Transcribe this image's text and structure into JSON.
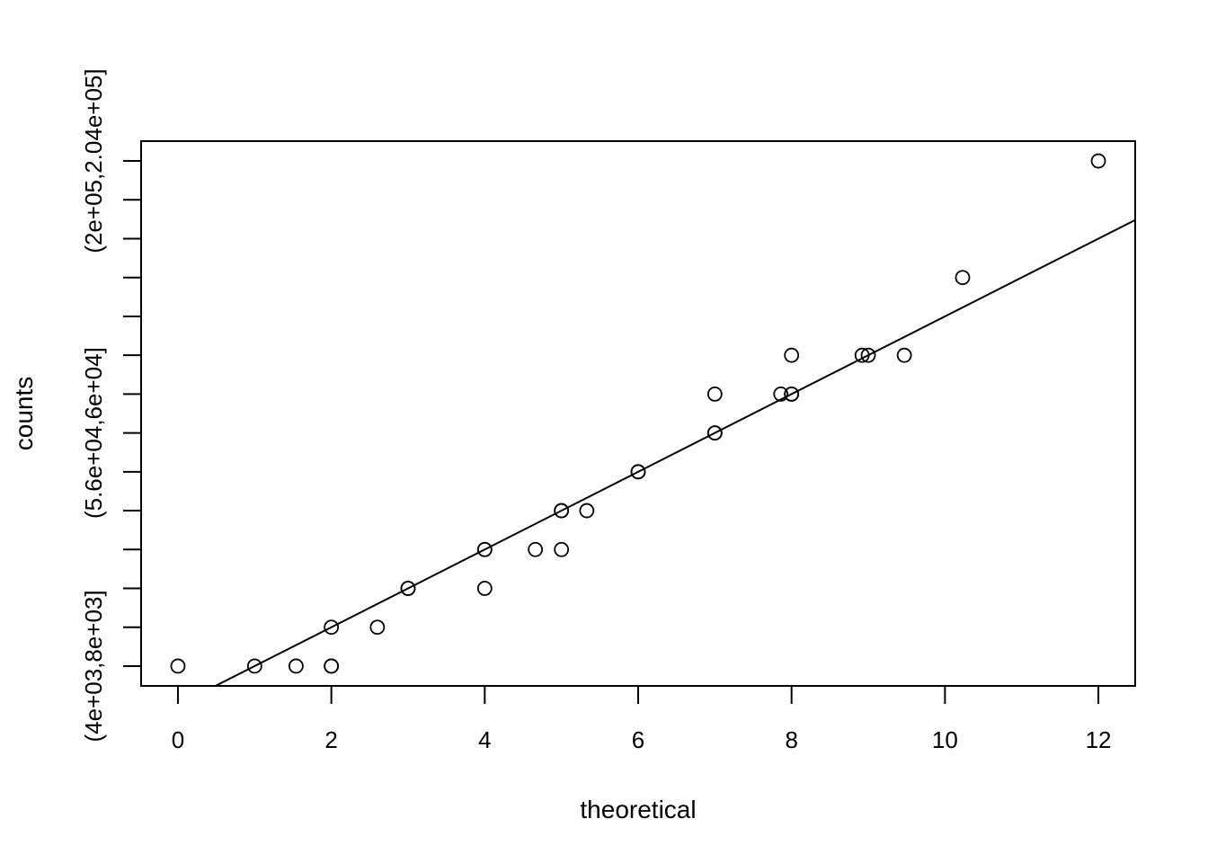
{
  "chart_data": {
    "type": "scatter",
    "title": "",
    "xlabel": "theoretical",
    "ylabel": "counts",
    "xlim": [
      -0.48,
      12.48
    ],
    "ylim_levels": [
      0.49,
      14.51
    ],
    "x_ticks": [
      0,
      2,
      4,
      6,
      8,
      10,
      12
    ],
    "x_tick_labels": [
      "0",
      "2",
      "4",
      "6",
      "8",
      "10",
      "12"
    ],
    "y_tick_levels": [
      1,
      2,
      3,
      4,
      5,
      6,
      7,
      8,
      9,
      10,
      11,
      12,
      13,
      14
    ],
    "y_tick_labels": [
      {
        "level": 1,
        "text": "(4e+03,8e+03]"
      },
      {
        "level": 7,
        "text": "(5.6e+04,6e+04]"
      },
      {
        "level": 14,
        "text": "(2e+05,2.04e+05]"
      }
    ],
    "points": [
      {
        "x": 0,
        "y": 1
      },
      {
        "x": 1,
        "y": 1
      },
      {
        "x": 1.54,
        "y": 1
      },
      {
        "x": 2,
        "y": 1
      },
      {
        "x": 2,
        "y": 1
      },
      {
        "x": 2,
        "y": 2
      },
      {
        "x": 2.6,
        "y": 2
      },
      {
        "x": 3,
        "y": 3
      },
      {
        "x": 3,
        "y": 3
      },
      {
        "x": 4,
        "y": 3
      },
      {
        "x": 4,
        "y": 4
      },
      {
        "x": 4,
        "y": 4
      },
      {
        "x": 4.66,
        "y": 4
      },
      {
        "x": 5,
        "y": 4
      },
      {
        "x": 5,
        "y": 5
      },
      {
        "x": 5,
        "y": 5
      },
      {
        "x": 5.33,
        "y": 5
      },
      {
        "x": 6,
        "y": 6
      },
      {
        "x": 6,
        "y": 6
      },
      {
        "x": 7,
        "y": 7
      },
      {
        "x": 7,
        "y": 7
      },
      {
        "x": 7,
        "y": 8
      },
      {
        "x": 7.86,
        "y": 8
      },
      {
        "x": 8,
        "y": 8
      },
      {
        "x": 8,
        "y": 8
      },
      {
        "x": 8,
        "y": 9
      },
      {
        "x": 8.92,
        "y": 9
      },
      {
        "x": 9,
        "y": 9
      },
      {
        "x": 9.47,
        "y": 9
      },
      {
        "x": 10.23,
        "y": 11
      },
      {
        "x": 12,
        "y": 14
      }
    ],
    "reference_line": {
      "intercept": 0,
      "slope": 1
    },
    "grid": false,
    "legend": "none"
  }
}
